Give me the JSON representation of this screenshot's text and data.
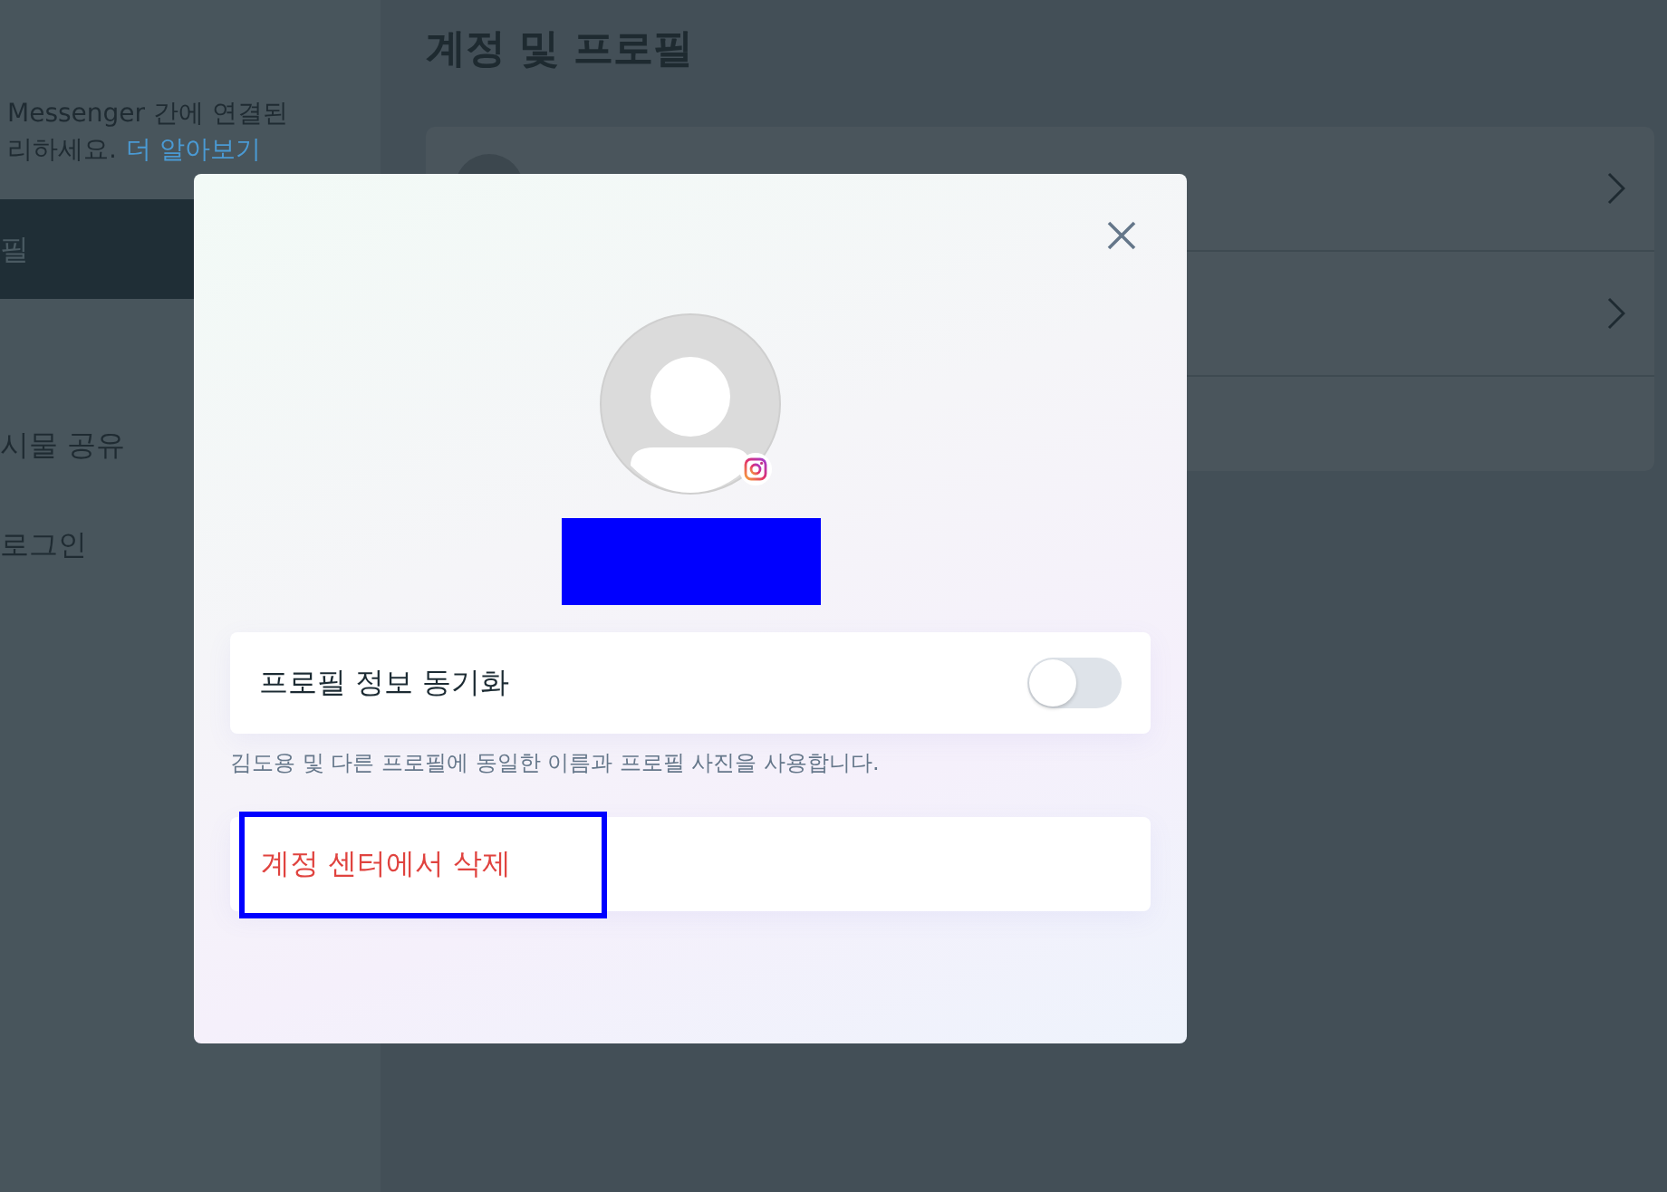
{
  "sidebar": {
    "description": "Messenger 간에 연결된",
    "description_2": "리하세요.",
    "learn_more_link": "더 알아보기",
    "items": [
      {
        "label": "필",
        "selected": true
      },
      {
        "label": "시물 공유",
        "selected": false
      },
      {
        "label": "로그인",
        "selected": false
      }
    ]
  },
  "main": {
    "title": "계정 및 프로필",
    "rows": [
      {
        "kind": "profile"
      },
      {
        "kind": "link"
      },
      {
        "kind": "empty"
      }
    ]
  },
  "dialog": {
    "name_redacted": true,
    "sync": {
      "label": "프로필 정보 동기화",
      "on": false
    },
    "hint": "김도용 및 다른 프로필에 동일한 이름과 프로필 사진을 사용합니다.",
    "delete_button": {
      "label": "계정 센터에서 삭제",
      "highlighted": true
    }
  }
}
